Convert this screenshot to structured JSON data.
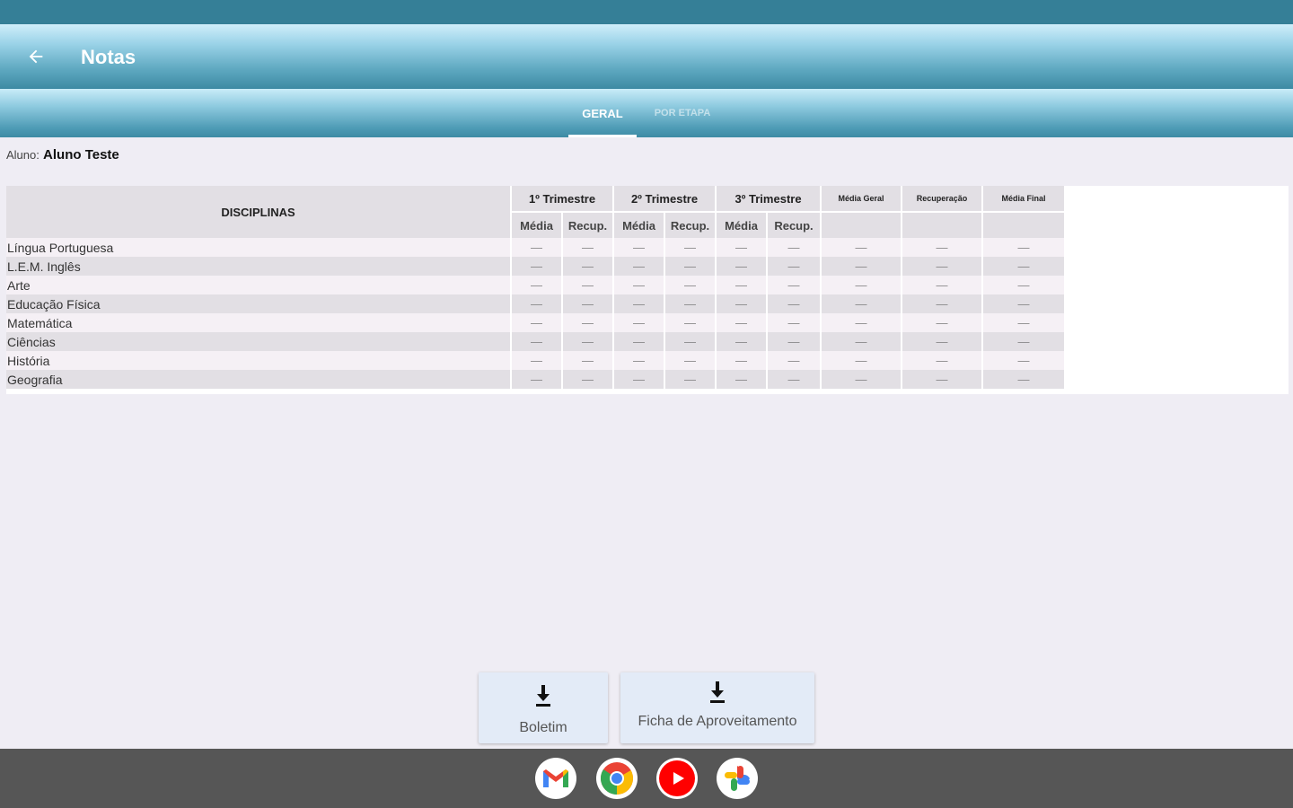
{
  "app_bar": {
    "title": "Notas",
    "back_icon": "arrow-left-icon"
  },
  "tabs": [
    {
      "label": "GERAL",
      "active": true
    },
    {
      "label": "POR ETAPA",
      "active": false
    }
  ],
  "student": {
    "label": "Aluno:",
    "name": "Aluno Teste"
  },
  "table": {
    "disciplines_header": "DISCIPLINAS",
    "group_headers": [
      "1º Trimestre",
      "2º Trimestre",
      "3º Trimestre"
    ],
    "extra_headers": [
      "Média Geral",
      "Recuperação",
      "Média Final"
    ],
    "sub_headers": [
      "Média",
      "Recup."
    ],
    "empty_value": "—",
    "rows": [
      {
        "name": "Língua Portuguesa"
      },
      {
        "name": "L.E.M. Inglês"
      },
      {
        "name": "Arte"
      },
      {
        "name": "Educação Física"
      },
      {
        "name": "Matemática"
      },
      {
        "name": "Ciências"
      },
      {
        "name": "História"
      },
      {
        "name": "Geografia"
      }
    ]
  },
  "buttons": {
    "boletim": {
      "label": "Boletim",
      "icon": "download-icon"
    },
    "ficha": {
      "label": "Ficha de Aproveitamento",
      "icon": "download-icon"
    }
  },
  "taskbar": {
    "apps": [
      {
        "name": "gmail-icon"
      },
      {
        "name": "chrome-icon"
      },
      {
        "name": "youtube-icon"
      },
      {
        "name": "photos-icon"
      }
    ]
  },
  "colors": {
    "status_bar": "#357f97",
    "header_gradient_top": "#cfeefa",
    "header_gradient_bottom": "#3d8aa3",
    "background": "#efedf4",
    "taskbar": "#565656"
  }
}
